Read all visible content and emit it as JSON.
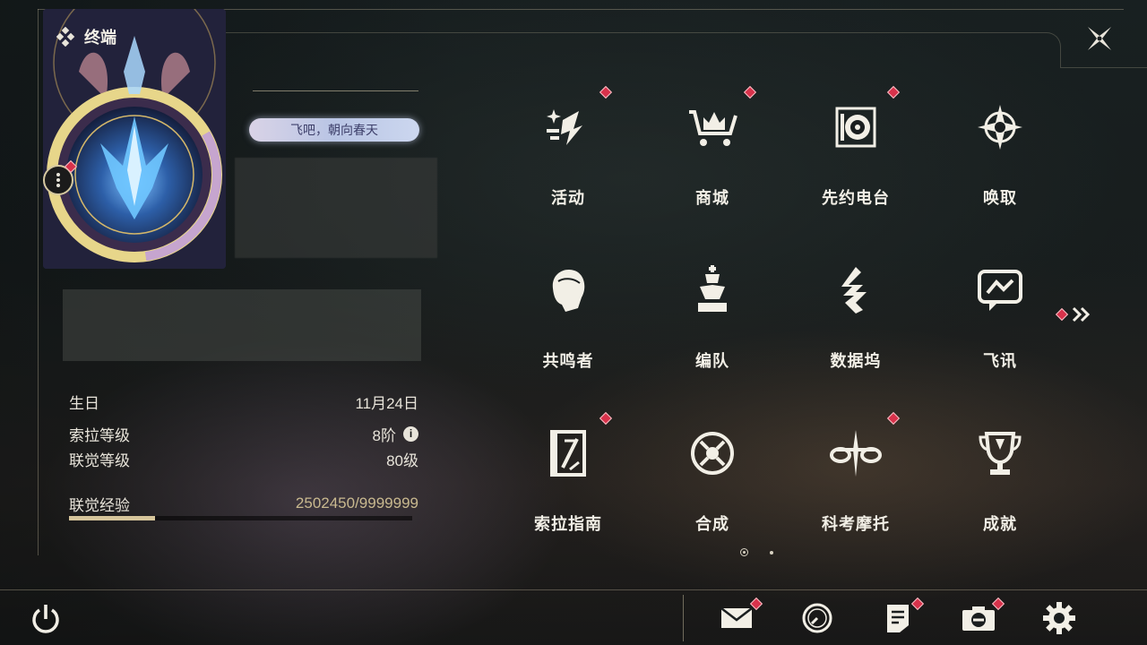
{
  "header": {
    "title": "终端"
  },
  "profile": {
    "title_badge": "飞吧，朝向春天"
  },
  "stats": [
    {
      "label": "生日",
      "value": "11月24日"
    },
    {
      "label": "索拉等级",
      "value": "8阶"
    },
    {
      "label": "联觉等级",
      "value": "80级"
    }
  ],
  "experience": {
    "label": "联觉经验",
    "value": "2502450/9999999",
    "progress": 0.25
  },
  "menu": [
    {
      "label": "活动",
      "icon": "activity-icon",
      "badge": true
    },
    {
      "label": "商城",
      "icon": "shop-cart-icon",
      "badge": true
    },
    {
      "label": "先约电台",
      "icon": "radio-icon",
      "badge": true
    },
    {
      "label": "唤取",
      "icon": "compass-star-icon",
      "badge": false
    },
    {
      "label": "共鸣者",
      "icon": "resonator-head-icon",
      "badge": false
    },
    {
      "label": "编队",
      "icon": "chess-team-icon",
      "badge": false
    },
    {
      "label": "数据坞",
      "icon": "data-dock-icon",
      "badge": false
    },
    {
      "label": "飞讯",
      "icon": "message-icon",
      "badge": false
    },
    {
      "label": "索拉指南",
      "icon": "guide-book-icon",
      "badge": true
    },
    {
      "label": "合成",
      "icon": "synthesis-icon",
      "badge": false
    },
    {
      "label": "科考摩托",
      "icon": "motorbike-icon",
      "badge": true
    },
    {
      "label": "成就",
      "icon": "trophy-icon",
      "badge": false
    }
  ],
  "bottom_bar": [
    {
      "name": "mail",
      "icon": "mail-icon",
      "badge": true
    },
    {
      "name": "clock",
      "icon": "clock-icon",
      "badge": false
    },
    {
      "name": "notice",
      "icon": "notice-icon",
      "badge": true
    },
    {
      "name": "camera",
      "icon": "camera-icon",
      "badge": true
    },
    {
      "name": "settings",
      "icon": "settings-gear-icon",
      "badge": false
    }
  ],
  "pagination": {
    "current": 1,
    "total": 2
  },
  "colors": {
    "accent": "#d6c59b",
    "badge_red": "#d8324b",
    "text": "#f2efe6"
  }
}
